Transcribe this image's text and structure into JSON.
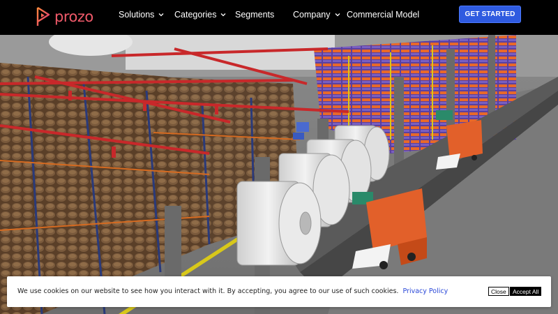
{
  "brand": {
    "name": "prozo",
    "accent": "#f05a6a"
  },
  "nav": {
    "items": [
      {
        "label": "Solutions",
        "has_dropdown": true
      },
      {
        "label": "Categories",
        "has_dropdown": true
      },
      {
        "label": "Segments",
        "has_dropdown": false
      },
      {
        "label": "Company",
        "has_dropdown": true
      },
      {
        "label": "Commercial Model",
        "has_dropdown": false
      }
    ],
    "cta_label": "GET STARTED",
    "cta_color": "#2f5be0"
  },
  "hero": {
    "image_icon": "warehouse-3d-scene"
  },
  "cookie": {
    "message": "We use cookies on our website to see how you interact with it. By accepting, you agree to our use of such cookies.",
    "link_label": "Privacy Policy",
    "close_label": "Close",
    "accept_label": "Accept All"
  }
}
